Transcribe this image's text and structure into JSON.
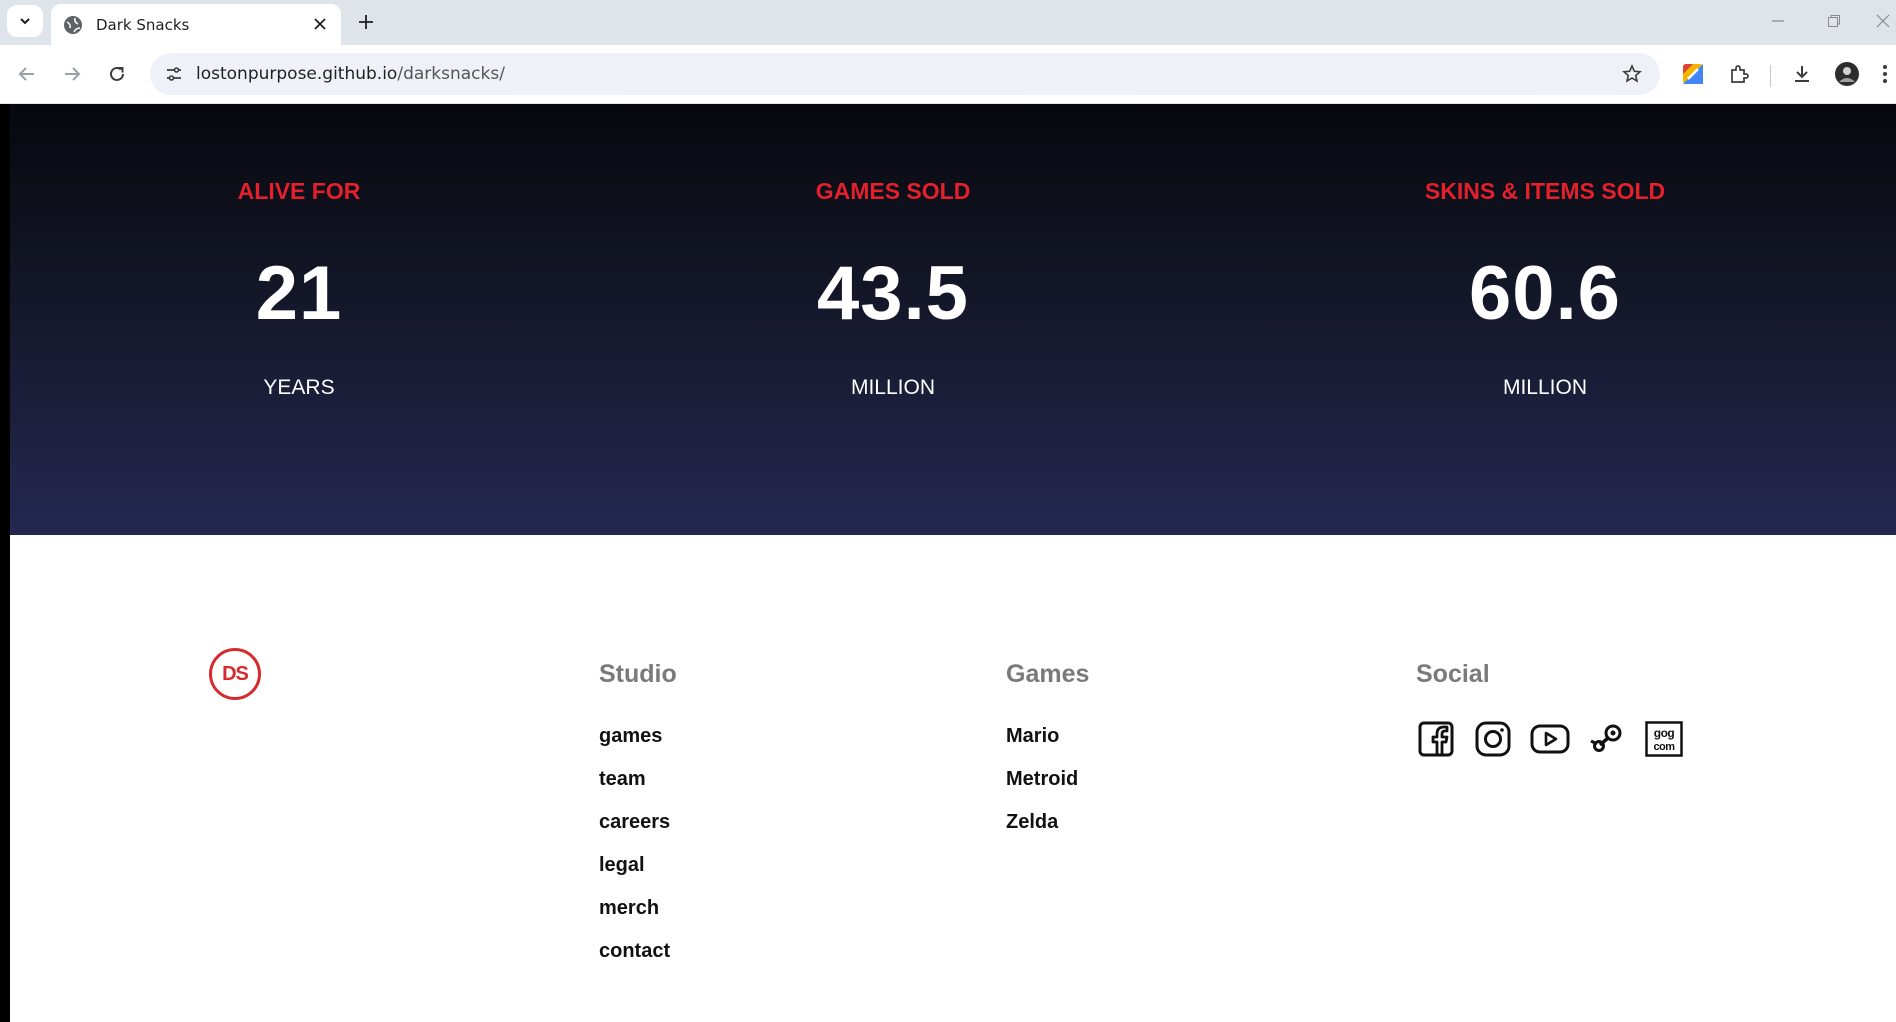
{
  "browser": {
    "tab_title": "Dark Snacks",
    "url_host": "lostonpurpose.github.io",
    "url_path": "/darksnacks/"
  },
  "stats": [
    {
      "label": "ALIVE FOR",
      "value": "21",
      "unit": "YEARS"
    },
    {
      "label": "GAMES SOLD",
      "value": "43.5",
      "unit": "MILLION"
    },
    {
      "label": "SKINS & ITEMS SOLD",
      "value": "60.6",
      "unit": "MILLION"
    }
  ],
  "footer": {
    "logo_text": "DS",
    "studio": {
      "heading": "Studio",
      "links": [
        "games",
        "team",
        "careers",
        "legal",
        "merch",
        "contact"
      ]
    },
    "games": {
      "heading": "Games",
      "links": [
        "Mario",
        "Metroid",
        "Zelda"
      ]
    },
    "social": {
      "heading": "Social",
      "icons": [
        "facebook-icon",
        "instagram-icon",
        "youtube-icon",
        "steam-icon",
        "gog-icon"
      ]
    }
  },
  "colors": {
    "accent_red": "#e3202b",
    "stats_bg_top": "#07080d",
    "stats_bg_bottom": "#242850",
    "footer_heading": "#7a7a7a"
  }
}
